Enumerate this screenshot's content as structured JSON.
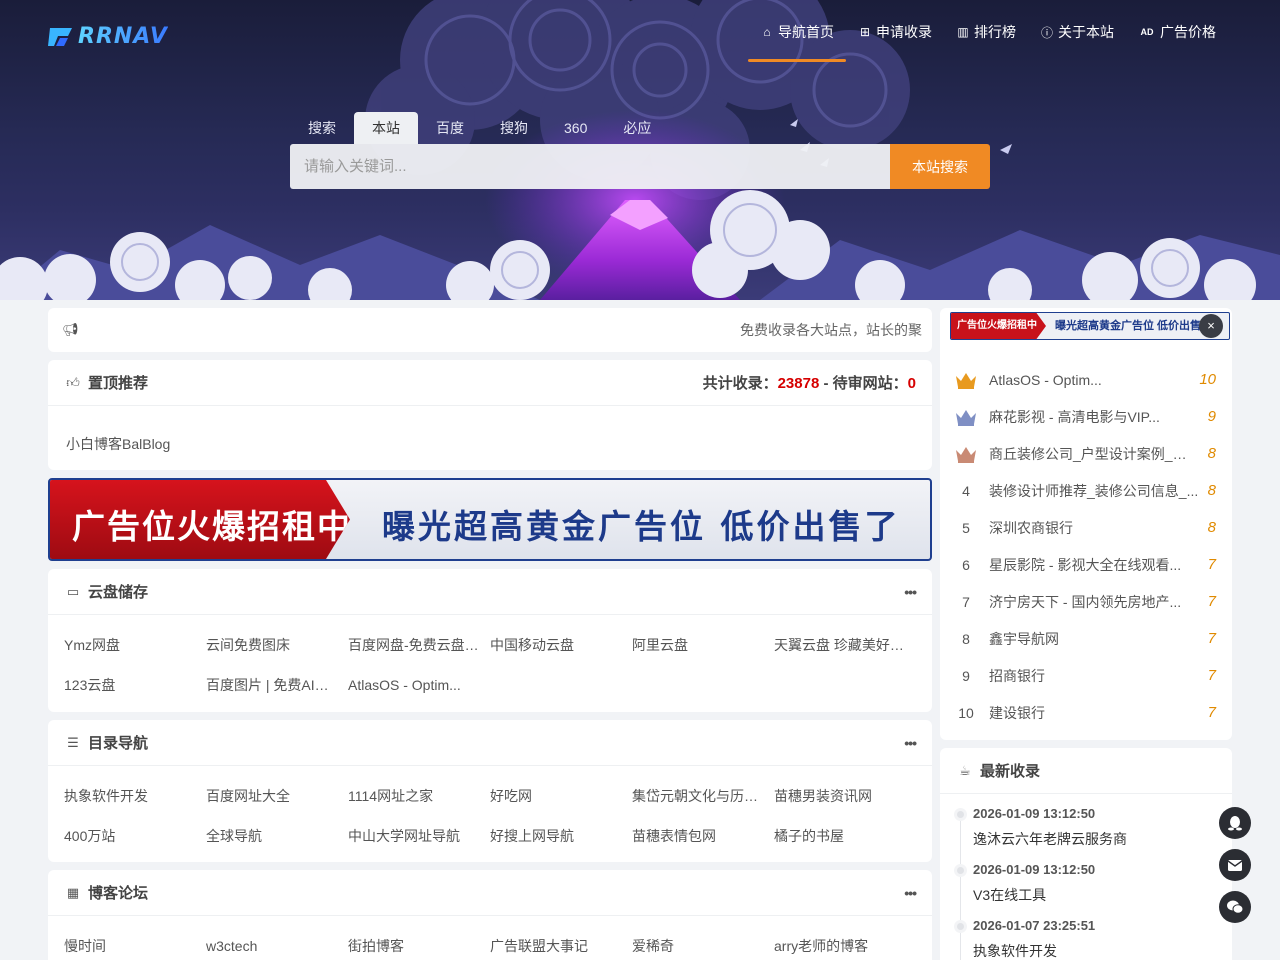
{
  "brand": {
    "logo_text": "RRNAV"
  },
  "nav": [
    {
      "icon": "home-icon",
      "label": "导航首页",
      "active": true
    },
    {
      "icon": "plus-square-icon",
      "label": "申请收录"
    },
    {
      "icon": "bar-chart-icon",
      "label": "排行榜"
    },
    {
      "icon": "info-icon",
      "label": "关于本站"
    },
    {
      "icon": "ad-icon",
      "label": "广告价格"
    }
  ],
  "search": {
    "tabs": [
      "搜索",
      "本站",
      "百度",
      "搜狗",
      "360",
      "必应"
    ],
    "active_tab": "本站",
    "placeholder": "请输入关键词...",
    "button": "本站搜索"
  },
  "notice": {
    "icon": "bullhorn-icon",
    "text": "免费收录各大站点，站长的聚"
  },
  "top_recommend": {
    "icon": "thumbs-up-icon",
    "title": "置顶推荐",
    "stats_total_label": "共计收录：",
    "stats_total": "23878",
    "stats_sep": " - ",
    "stats_pending_label": "待审网站：",
    "stats_pending": "0",
    "item": "小白博客BalBlog"
  },
  "banner": {
    "left": "广告位火爆招租中",
    "right": "曝光超高黄金广告位 低价出售了"
  },
  "sections": [
    {
      "icon": "hdd-icon",
      "title": "云盘储存",
      "more": "•••",
      "links": [
        "Ymz网盘",
        "云间免费图床",
        "百度网盘-免费云盘丨...",
        "中国移动云盘",
        "阿里云盘",
        "天翼云盘 珍藏美好生活...",
        "123云盘",
        "百度图片 | 免费AI图...",
        "AtlasOS - Optim..."
      ]
    },
    {
      "icon": "list-icon",
      "title": "目录导航",
      "more": "•••",
      "links": [
        "执象软件开发",
        "百度网址大全",
        "1114网址之家",
        "好吃网",
        "集岱元朝文化与历史网",
        "苗穗男装资讯网",
        "400万站",
        "全球导航",
        "中山大学网址导航",
        "好搜上网导航",
        "苗穗表情包网",
        "橘子的书屋"
      ]
    },
    {
      "icon": "table-icon",
      "title": "博客论坛",
      "more": "•••",
      "links": [
        "慢时间",
        "w3ctech",
        "街拍博客",
        "广告联盟大事记",
        "爱稀奇",
        "arry老师的博客"
      ]
    }
  ],
  "hot": {
    "ad_left": "广告位火爆招租中",
    "ad_right": "曝光超高黄金广告位 低价出售了",
    "close": "×",
    "items": [
      {
        "rank": "1",
        "name": "AtlasOS - Optim...",
        "count": "10"
      },
      {
        "rank": "2",
        "name": "麻花影视 - 高清电影与VIP...",
        "count": "9"
      },
      {
        "rank": "3",
        "name": "商丘装修公司_户型设计案例_报价...",
        "count": "8"
      },
      {
        "rank": "4",
        "name": "装修设计师推荐_装修公司信息_...",
        "count": "8"
      },
      {
        "rank": "5",
        "name": "深圳农商银行",
        "count": "8"
      },
      {
        "rank": "6",
        "name": "星辰影院 - 影视大全在线观看...",
        "count": "7"
      },
      {
        "rank": "7",
        "name": "济宁房天下 - 国内领先房地产...",
        "count": "7"
      },
      {
        "rank": "8",
        "name": "鑫宇导航网",
        "count": "7"
      },
      {
        "rank": "9",
        "name": "招商银行",
        "count": "7"
      },
      {
        "rank": "10",
        "name": "建设银行",
        "count": "7"
      }
    ],
    "crown_colors": [
      "#e89a1f",
      "#7f8fc4",
      "#c98a74"
    ]
  },
  "latest": {
    "icon": "coffee-icon",
    "title": "最新收录",
    "items": [
      {
        "time": "2026-01-09 13:12:50",
        "title": "逸沐云六年老牌云服务商"
      },
      {
        "time": "2026-01-09 13:12:50",
        "title": "V3在线工具"
      },
      {
        "time": "2026-01-07 23:25:51",
        "title": "执象软件开发"
      }
    ]
  },
  "float_buttons": [
    "qq-icon",
    "mail-icon",
    "wechat-icon"
  ],
  "colors": {
    "accent": "#f08a24",
    "stat_red": "#d60000",
    "count_orange": "#e08a00"
  }
}
